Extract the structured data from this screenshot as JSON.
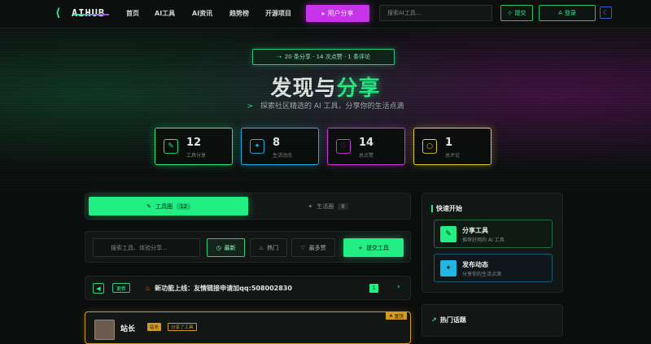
{
  "nav": {
    "logo_text": "AIHUB",
    "links": [
      "首页",
      "AI工具",
      "AI资讯",
      "趋势榜",
      "开源项目"
    ],
    "share_button": "用户分享",
    "search_placeholder": "搜索AI工具...",
    "submit_button": "提交",
    "login_button": "登录"
  },
  "hero": {
    "stat_pill": "20 条分享 · 14 次点赞 · 1 条评论",
    "title_main": "发现与",
    "title_accent": "分享",
    "subtitle_prompt": ">",
    "subtitle": "探索社区精选的 AI 工具，分享你的生活点滴",
    "stats": [
      {
        "value": "12",
        "label": "工具分享",
        "color": "#2bf08a"
      },
      {
        "value": "8",
        "label": "生活动态",
        "color": "#1fb8e6"
      },
      {
        "value": "14",
        "label": "总点赞",
        "color": "#d43ce0"
      },
      {
        "value": "1",
        "label": "总评论",
        "color": "#e8d62a"
      }
    ]
  },
  "tabs": {
    "active_label": "工具圈",
    "active_count": "12",
    "inactive_label": "生活圈",
    "inactive_count": "8"
  },
  "filter": {
    "search_placeholder": "搜索工具、体验分享...",
    "latest": "最新",
    "hot": "热门",
    "most_liked": "最多赞",
    "submit": "提交工具"
  },
  "notice": {
    "tag": "更新",
    "text": "新功能上线：友情链接申请加qq:508002830",
    "page": "1"
  },
  "post": {
    "author": "站长",
    "role1": "站长",
    "role2": "分享了工具",
    "pin": "置顶"
  },
  "sidebar": {
    "quick_title": "快速开始",
    "share_tool_title": "分享工具",
    "share_tool_sub": "推荐好用的 AI 工具",
    "post_title": "发布动态",
    "post_sub": "分享你的生活点滴",
    "hot_title": "热门话题"
  }
}
